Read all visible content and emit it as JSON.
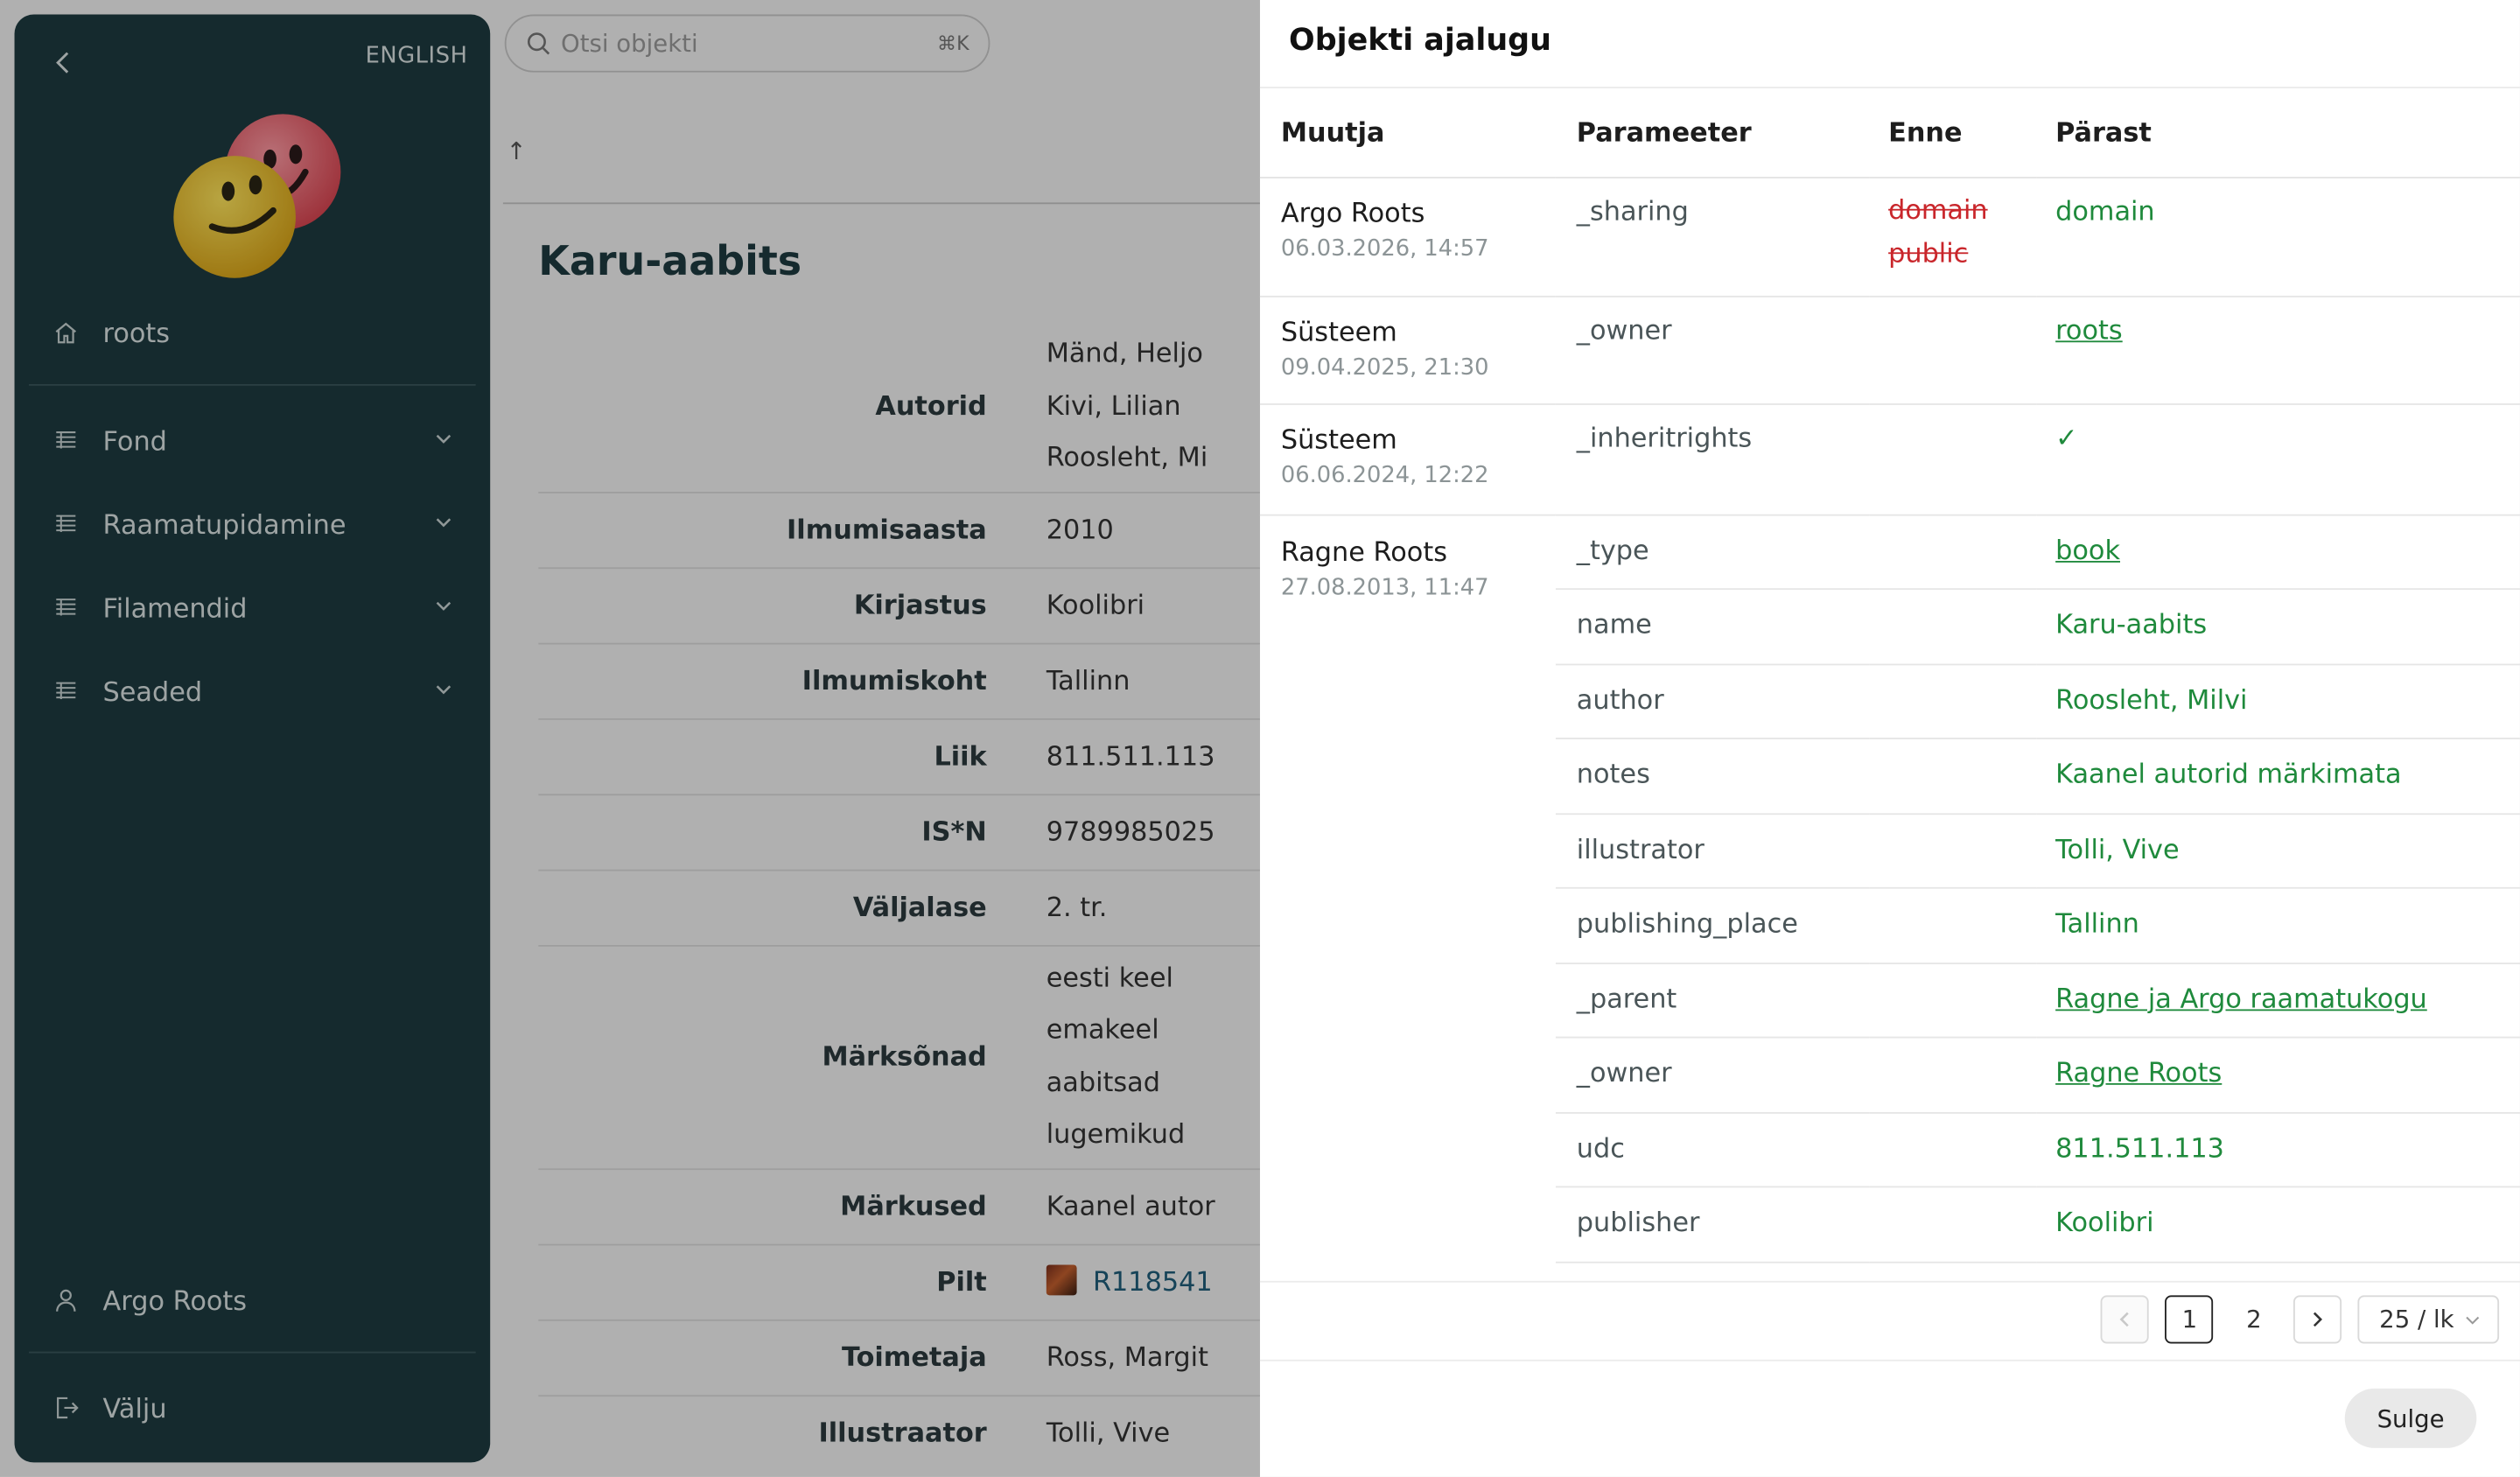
{
  "sidebar": {
    "language": "ENGLISH",
    "top_item": "roots",
    "menu": [
      {
        "label": "Fond"
      },
      {
        "label": "Raamatupidamine"
      },
      {
        "label": "Filamendid"
      },
      {
        "label": "Seaded"
      }
    ],
    "user": "Argo Roots",
    "logout": "Välju"
  },
  "search": {
    "placeholder": "Otsi objekti",
    "shortcut": "⌘K"
  },
  "entity": {
    "title": "Karu-aabits",
    "properties": {
      "authors_label": "Autorid",
      "authors": [
        "Mänd, Heljo",
        "Kivi, Lilian",
        "Roosleht, Mi"
      ],
      "year_label": "Ilmumisaasta",
      "year": "2010",
      "publisher_label": "Kirjastus",
      "publisher": "Koolibri",
      "place_label": "Ilmumiskoht",
      "place": "Tallinn",
      "type_label": "Liik",
      "type": "811.511.113",
      "isbn_label": "IS*N",
      "isbn": "9789985025",
      "edition_label": "Väljalase",
      "edition": "2. tr.",
      "keywords_label": "Märksõnad",
      "keywords": [
        "eesti keel",
        "emakeel",
        "aabitsad",
        "lugemikud"
      ],
      "notes_label": "Märkused",
      "notes": "Kaanel autor",
      "image_label": "Pilt",
      "image": "R118541",
      "editor_label": "Toimetaja",
      "editor": "Ross, Margit",
      "illustrator_label": "Illustraator",
      "illustrator": "Tolli, Vive"
    }
  },
  "drawer": {
    "title": "Objekti ajalugu",
    "columns": {
      "changer": "Muutja",
      "parameter": "Parameeter",
      "before": "Enne",
      "after": "Pärast"
    },
    "entries": {
      "e1": {
        "who": "Argo Roots",
        "when": "06.03.2026, 14:57",
        "param": "_sharing",
        "before": [
          "domain",
          "public"
        ],
        "after": "domain"
      },
      "e2": {
        "who": "Süsteem",
        "when": "09.04.2025, 21:30",
        "param": "_owner",
        "after": "roots"
      },
      "e3": {
        "who": "Süsteem",
        "when": "06.06.2024, 12:22",
        "param": "_inheritrights",
        "after": "✓"
      },
      "e4": {
        "who": "Ragne Roots",
        "when": "27.08.2013, 11:47",
        "changes": [
          {
            "param": "_type",
            "after": "book"
          },
          {
            "param": "name",
            "after": "Karu-aabits"
          },
          {
            "param": "author",
            "after": "Roosleht, Milvi"
          },
          {
            "param": "notes",
            "after": "Kaanel autorid märkimata"
          },
          {
            "param": "illustrator",
            "after": "Tolli, Vive"
          },
          {
            "param": "publishing_place",
            "after": "Tallinn"
          },
          {
            "param": "_parent",
            "after": "Ragne ja Argo raamatukogu"
          },
          {
            "param": "_owner",
            "after": "Ragne Roots"
          },
          {
            "param": "udc",
            "after": "811.511.113"
          },
          {
            "param": "publisher",
            "after": "Koolibri"
          }
        ]
      }
    },
    "pagination": {
      "pages": [
        "1",
        "2"
      ],
      "current": "1",
      "page_size": "25 / lk"
    },
    "close_label": "Sulge"
  },
  "colors": {
    "sidebar_bg": "#1e3b40",
    "added": "#1f8a3c",
    "removed": "#c9262b"
  }
}
